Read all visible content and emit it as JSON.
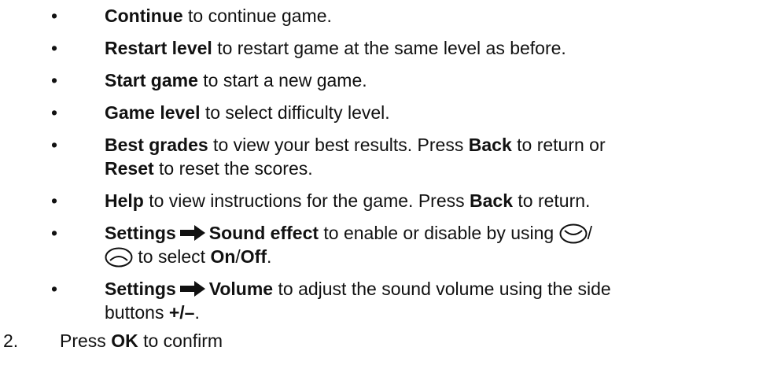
{
  "bullet_char": "•",
  "items": [
    {
      "bold": "Continue",
      "text": " to continue game."
    },
    {
      "bold": "Restart level",
      "text": " to restart game at the same level as before."
    },
    {
      "bold": "Start game",
      "text": " to start a new game."
    },
    {
      "bold": "Game level",
      "text": " to select difficulty level."
    },
    {
      "bold": "Best grades",
      "text1": " to view your best results. Press ",
      "bold2": "Back",
      "text2": " to return or",
      "bold3": "Reset",
      "text3": " to reset the scores."
    },
    {
      "bold": "Help",
      "text1": " to view instructions for the game. Press ",
      "bold2": "Back",
      "text2": " to return."
    },
    {
      "bold": "Settings",
      "bold2": "Sound effect",
      "text1": " to enable or disable by using ",
      "slash": "/",
      "text2": " to select ",
      "bold3": "On",
      "slash2": "/",
      "bold4": "Off",
      "period": ".",
      "icon_down": "down-key-icon",
      "icon_up": "up-key-icon"
    },
    {
      "bold": "Settings",
      "bold2": "Volume",
      "text1": " to adjust the sound volume using the side",
      "text2": "buttons ",
      "bold3": "+/–",
      "period": "."
    }
  ],
  "step": {
    "number": "2.",
    "text1": "Press ",
    "bold": "OK",
    "text2": " to confirm"
  }
}
